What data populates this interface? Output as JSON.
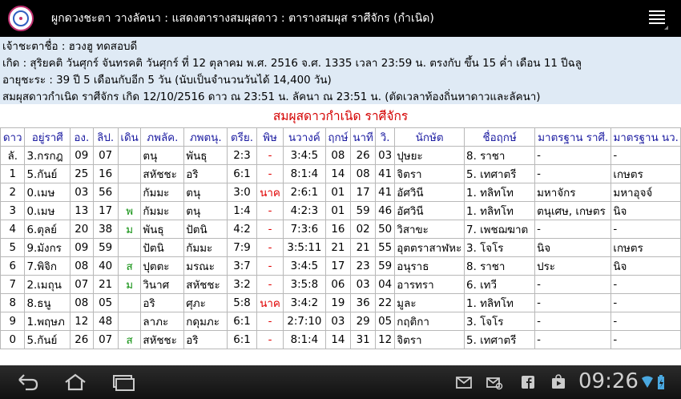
{
  "topbar": {
    "title": "ผูกดวงชะตา วางลัคนา :   แสดงตารางสมผุสดาว : ตารางสมผุส ราศีจักร (กำเนิด)",
    "menu_icon": "menu-icon"
  },
  "info": {
    "line1": "เจ้าชะตาชื่อ : ฮวงฮู ทดสอบดี",
    "line2": "เกิด : สุริยคติ วันศุกร์ จันทรคติ วันศุกร์ ที่ 12 ตุลาคม พ.ศ. 2516 จ.ศ. 1335 เวลา 23:59 น.  ตรงกับ ขึ้น 15 ค่ำ เดือน 11 ปีฉลู",
    "line3": "อายุชะระ : 39 ปี 5 เดือนกับอีก 5 วัน (นับเป็นจำนวนวันได้ 14,400 วัน)",
    "line4": "สมผุสดาวกำเนิด ราศีจักร  เกิด 12/10/2516 ดาว ณ 23:51 น. ลัคนา ณ 23:51 น. (ตัดเวลาท้องถิ่นหาดาวและลัคนา)"
  },
  "table": {
    "title": "สมผุสดาวกำเนิด ราศีจักร",
    "headers": [
      "ดาว",
      "อยู่ราศี",
      "อง.",
      "ลิป.",
      "เดิน",
      "ภพลัค.",
      "ภพตนุ.",
      "ตรีย.",
      "พิษ",
      "นวางค์",
      "ฤกษ์",
      "นาที",
      "วิ.",
      "นักษัต",
      "ชื่อฤกษ์",
      "มาตรฐาน ราศี.",
      "มาตรฐาน นว."
    ],
    "rows": [
      [
        "ลั.",
        "3.กรกฎ",
        "09",
        "07",
        "",
        "ตนุ",
        "พันธุ",
        "2:3",
        "-",
        "3:4:5",
        "08",
        "26",
        "03",
        "ปุษยะ",
        "8. ราชา",
        "-",
        "-"
      ],
      [
        "1",
        "5.กันย์",
        "25",
        "16",
        "",
        "สหัชชะ",
        "อริ",
        "6:1",
        "-",
        "8:1:4",
        "14",
        "08",
        "41",
        "จิตรา",
        "5. เทศาตรี",
        "-",
        "เกษตร"
      ],
      [
        "2",
        "0.เมษ",
        "03",
        "56",
        "",
        "กัมมะ",
        "ตนุ",
        "3:0",
        "นาค",
        "2:6:1",
        "01",
        "17",
        "41",
        "อัศวินี",
        "1. ทลิทโท",
        "มหาจักร",
        "มหาอุจจ์"
      ],
      [
        "3",
        "0.เมษ",
        "13",
        "17",
        "พ",
        "กัมมะ",
        "ตนุ",
        "1:4",
        "-",
        "4:2:3",
        "01",
        "59",
        "46",
        "อัศวินี",
        "1. ทลิทโท",
        "ตนุเศษ, เกษตร",
        "นิจ"
      ],
      [
        "4",
        "6.ตุลย์",
        "20",
        "38",
        "ม",
        "พันธุ",
        "ปัตนิ",
        "4:2",
        "-",
        "7:3:6",
        "16",
        "02",
        "50",
        "วิสาขะ",
        "7. เพชฌฆาต",
        "-",
        "-"
      ],
      [
        "5",
        "9.มังกร",
        "09",
        "59",
        "",
        "ปัตนิ",
        "กัมมะ",
        "7:9",
        "-",
        "3:5:11",
        "21",
        "21",
        "55",
        "อุตตราสาฬหะ",
        "3. โจโร",
        "นิจ",
        "เกษตร"
      ],
      [
        "6",
        "7.พิจิก",
        "08",
        "40",
        "ส",
        "ปุตตะ",
        "มรณะ",
        "3:7",
        "-",
        "3:4:5",
        "17",
        "23",
        "59",
        "อนุราธ",
        "8. ราชา",
        "ประ",
        "นิจ"
      ],
      [
        "7",
        "2.เมถุน",
        "07",
        "21",
        "ม",
        "วินาศ",
        "สหัชชะ",
        "3:2",
        "-",
        "3:5:8",
        "06",
        "03",
        "04",
        "อารทรา",
        "6. เทวี",
        "-",
        "-"
      ],
      [
        "8",
        "8.ธนู",
        "08",
        "05",
        "",
        "อริ",
        "ศุภะ",
        "5:8",
        "นาค",
        "3:4:2",
        "19",
        "36",
        "22",
        "มูละ",
        "1. ทลิทโท",
        "-",
        "-"
      ],
      [
        "9",
        "1.พฤษภ",
        "12",
        "48",
        "",
        "ลาภะ",
        "กดุมภะ",
        "6:1",
        "-",
        "2:7:10",
        "03",
        "29",
        "05",
        "กฤติกา",
        "3. โจโร",
        "-",
        "-"
      ],
      [
        "0",
        "5.กันย์",
        "26",
        "07",
        "ส",
        "สหัชชะ",
        "อริ",
        "6:1",
        "-",
        "8:1:4",
        "14",
        "31",
        "12",
        "จิตรา",
        "5. เทศาตรี",
        "-",
        "-"
      ]
    ]
  },
  "navbar": {
    "clock": "09:26",
    "back_icon": "back-icon",
    "home_icon": "home-icon",
    "recent_icon": "recent-apps-icon"
  }
}
